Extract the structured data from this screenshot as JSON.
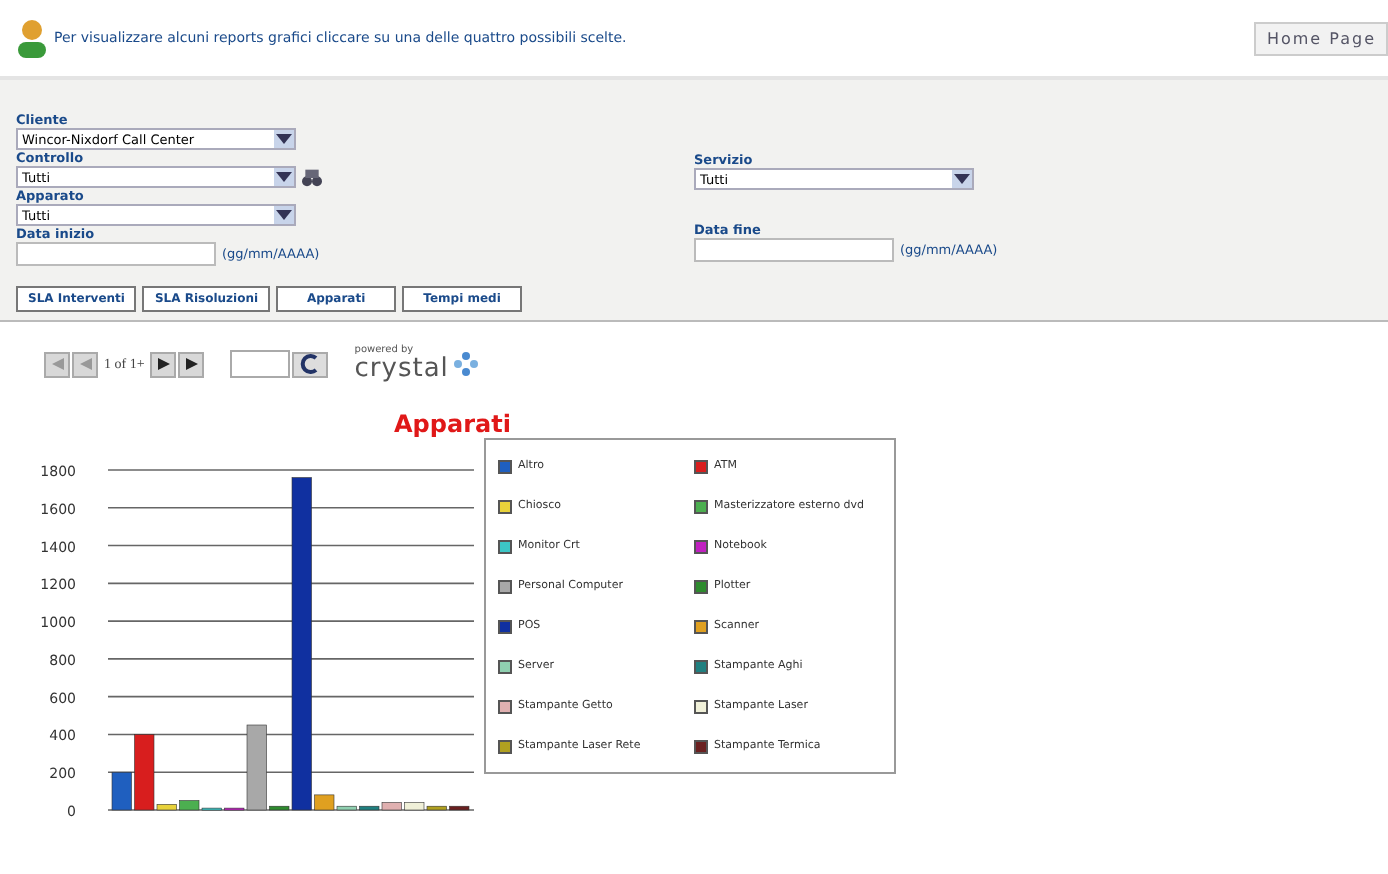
{
  "header": {
    "message": "Per visualizzare alcuni reports grafici cliccare su una delle quattro possibili scelte.",
    "home_button": "Home Page"
  },
  "form": {
    "left": [
      {
        "label": "Cliente",
        "kind": "select",
        "value": "Wincor-Nixdorf Call Center"
      },
      {
        "label": "Controllo",
        "kind": "select",
        "value": "Tutti",
        "icon": true
      },
      {
        "label": "Apparato",
        "kind": "select",
        "value": "Tutti"
      },
      {
        "label": "Data inizio",
        "kind": "date",
        "hint": "(gg/mm/AAAA)"
      }
    ],
    "right": [
      {
        "label": "Servizio",
        "kind": "select",
        "value": "Tutti"
      },
      {
        "label": "Data fine",
        "kind": "date",
        "hint": "(gg/mm/AAAA)"
      }
    ],
    "buttons": [
      "SLA Interventi",
      "SLA Risoluzioni",
      "Apparati",
      "Tempi medi"
    ]
  },
  "viewer": {
    "page_text": "1 of 1+",
    "powered_by": "powered by",
    "brand": "crystal"
  },
  "chart": {
    "chart_data": {
      "type": "bar",
      "title": "Apparati",
      "grid": true,
      "legend": true,
      "ylim": [
        0,
        1800
      ],
      "yticks": [
        0,
        200,
        400,
        600,
        800,
        1000,
        1200,
        1400,
        1600,
        1800
      ],
      "series": [
        {
          "name": "Altro",
          "color": "#1f5fbf",
          "values": [
            200
          ]
        },
        {
          "name": "ATM",
          "color": "#d81e1e",
          "values": [
            400
          ]
        },
        {
          "name": "Chiosco",
          "color": "#e8d23a",
          "values": [
            30
          ]
        },
        {
          "name": "Masterizzatore esterno dvd",
          "color": "#4caf50",
          "values": [
            50
          ]
        },
        {
          "name": "Monitor Crt",
          "color": "#3cc6c6",
          "values": [
            10
          ]
        },
        {
          "name": "Notebook",
          "color": "#c020c0",
          "values": [
            10
          ]
        },
        {
          "name": "Personal Computer",
          "color": "#a8a8a8",
          "values": [
            450
          ]
        },
        {
          "name": "Plotter",
          "color": "#2e8b2e",
          "values": [
            20
          ]
        },
        {
          "name": "POS",
          "color": "#1030a0",
          "values": [
            1760
          ]
        },
        {
          "name": "Scanner",
          "color": "#e0a020",
          "values": [
            80
          ]
        },
        {
          "name": "Server",
          "color": "#8fd0b0",
          "values": [
            20
          ]
        },
        {
          "name": "Stampante Aghi",
          "color": "#208080",
          "values": [
            20
          ]
        },
        {
          "name": "Stampante Getto",
          "color": "#e0b0b0",
          "values": [
            40
          ]
        },
        {
          "name": "Stampante Laser",
          "color": "#f0f0d8",
          "values": [
            40
          ]
        },
        {
          "name": "Stampante Laser Rete",
          "color": "#b0a020",
          "values": [
            20
          ]
        },
        {
          "name": "Stampante Termica",
          "color": "#6a2020",
          "values": [
            20
          ]
        }
      ]
    }
  }
}
